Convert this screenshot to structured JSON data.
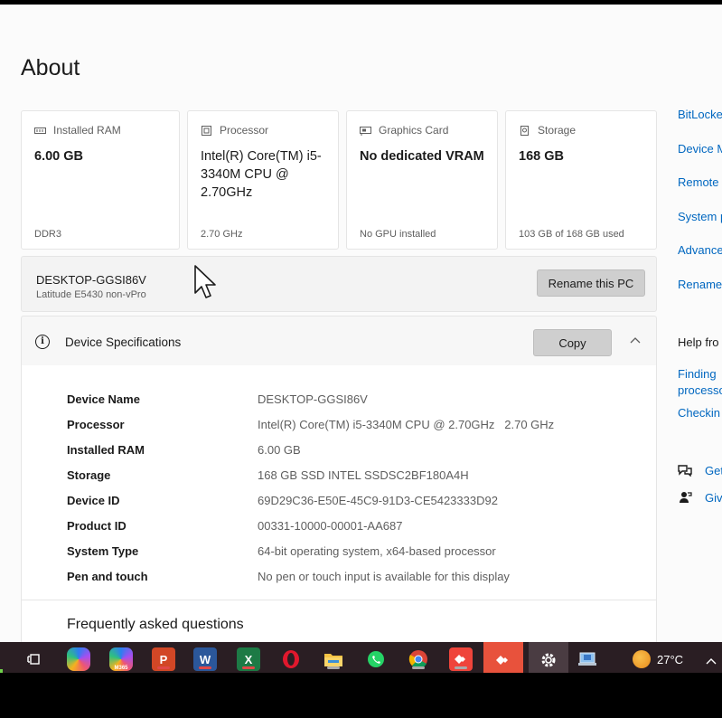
{
  "page": {
    "title": "About"
  },
  "cards": [
    {
      "label": "Installed RAM",
      "value": "6.00 GB",
      "sub": "DDR3",
      "icon": "ram-icon"
    },
    {
      "label": "Processor",
      "value": "Intel(R) Core(TM) i5-3340M CPU @ 2.70GHz",
      "sub": "2.70 GHz",
      "icon": "processor-icon"
    },
    {
      "label": "Graphics Card",
      "value": "No dedicated VRAM",
      "sub": "No GPU installed",
      "icon": "graphics-card-icon"
    },
    {
      "label": "Storage",
      "value": "168 GB",
      "sub": "103 GB of 168 GB used",
      "icon": "storage-icon"
    }
  ],
  "pc": {
    "name": "DESKTOP-GGSI86V",
    "model": "Latitude E5430 non-vPro",
    "rename_label": "Rename this PC"
  },
  "specs": {
    "title": "Device Specifications",
    "copy_label": "Copy",
    "rows": [
      {
        "label": "Device Name",
        "value": "DESKTOP-GGSI86V"
      },
      {
        "label": "Processor",
        "value": "Intel(R) Core(TM) i5-3340M CPU @ 2.70GHz   2.70 GHz"
      },
      {
        "label": "Installed RAM",
        "value": "6.00 GB"
      },
      {
        "label": "Storage",
        "value": "168 GB SSD INTEL SSDSC2BF180A4H"
      },
      {
        "label": "Device ID",
        "value": "69D29C36-E50E-45C9-91D3-CE5423333D92"
      },
      {
        "label": "Product ID",
        "value": "00331-10000-00001-AA687"
      },
      {
        "label": "System Type",
        "value": "64-bit operating system, x64-based processor"
      },
      {
        "label": "Pen and touch",
        "value": "No pen or touch input is available for this display"
      }
    ]
  },
  "faq": {
    "title": "Frequently asked questions"
  },
  "sidebar": {
    "links": [
      "BitLocke",
      "Device M",
      "Remote",
      "System p",
      "Advance",
      "Rename"
    ],
    "help_heading": "Help fro",
    "help_links": [
      "Finding",
      "processo",
      "Checkin"
    ],
    "actions": [
      "Get",
      "Giv"
    ]
  },
  "taskbar": {
    "apps": [
      "task-view",
      "copilot",
      "microsoft-365",
      "powerpoint",
      "word",
      "excel",
      "opera",
      "file-explorer",
      "whatsapp",
      "chrome",
      "anydesk",
      "anydesk-active",
      "settings",
      "remote-desktop"
    ],
    "m365_label": "M365",
    "temperature": "27°C"
  },
  "colors": {
    "accent": "#0067c0",
    "taskbar": "#2a1e23",
    "button": "#cfcfcf"
  }
}
